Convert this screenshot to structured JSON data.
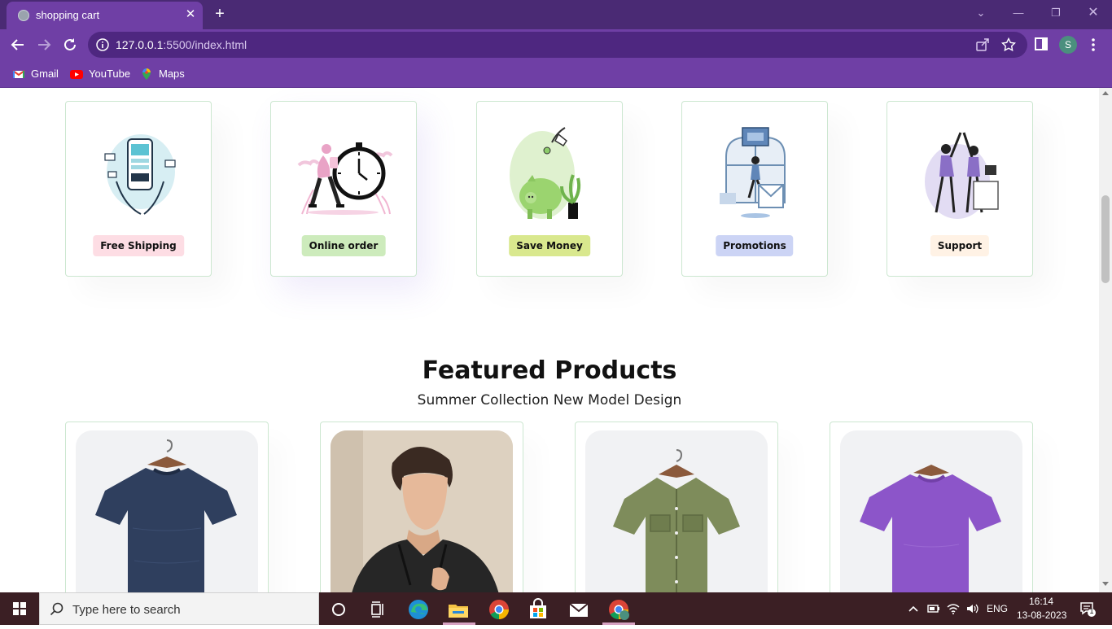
{
  "browser": {
    "tab_title": "shopping cart",
    "url_host": "127.0.0.1",
    "url_path": ":5500/index.html",
    "profile_initial": "S",
    "bookmarks": [
      {
        "label": "Gmail",
        "icon": "gmail-icon"
      },
      {
        "label": "YouTube",
        "icon": "youtube-icon"
      },
      {
        "label": "Maps",
        "icon": "maps-icon"
      }
    ]
  },
  "features": [
    {
      "label": "Free Shipping",
      "badge_color": "#fddde4"
    },
    {
      "label": "Online order",
      "badge_color": "#cdebbc"
    },
    {
      "label": "Save Money",
      "badge_color": "#d9e88e"
    },
    {
      "label": "Promotions",
      "badge_color": "#ccd4f5"
    },
    {
      "label": "Support",
      "badge_color": "#fff2e5"
    }
  ],
  "featured": {
    "title": "Featured Products",
    "subtitle": "Summer Collection New Model Design"
  },
  "products": [
    {
      "name": "navy-tshirt",
      "color": "#2b3a57"
    },
    {
      "name": "model-portrait",
      "color": "#2a2a2a"
    },
    {
      "name": "olive-shirt",
      "color": "#7b8a58"
    },
    {
      "name": "purple-tshirt",
      "color": "#8c55c9"
    }
  ],
  "taskbar": {
    "search_placeholder": "Type here to search",
    "language": "ENG",
    "time": "16:14",
    "date": "13-08-2023",
    "notification_count": "1"
  },
  "colors": {
    "accent": "#6f3fa5",
    "tabstrip": "#4a2a74",
    "card_border": "#cce7d0"
  }
}
